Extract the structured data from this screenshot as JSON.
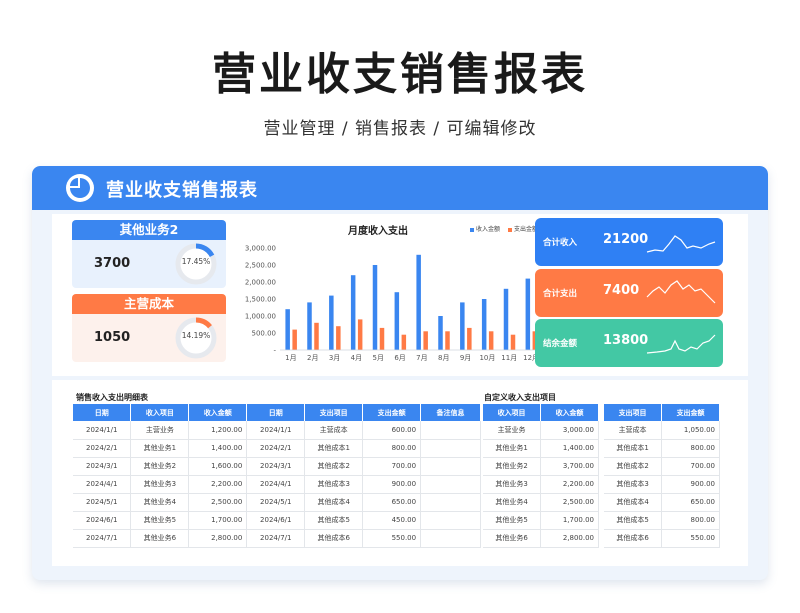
{
  "hero": {
    "title": "营业收支销售报表",
    "subtitle": "营业管理 / 销售报表 / 可编辑修改"
  },
  "panel": {
    "title": "营业收支销售报表",
    "logo_icon": "pie-chart-icon",
    "accent": "#3a86f0"
  },
  "kpi_cards": [
    {
      "label": "其他业务2",
      "value": "3700",
      "pct": "17.45%",
      "pct_value": 0.1745,
      "color": "#3a86f0"
    },
    {
      "label": "主营成本",
      "value": "1050",
      "pct": "14.19%",
      "pct_value": 0.1419,
      "color": "#ff7a45"
    }
  ],
  "summary_cards": [
    {
      "label": "合计收入",
      "value": "21200",
      "color": "#2f80f4",
      "icon": "sparkline-icon"
    },
    {
      "label": "合计支出",
      "value": "7400",
      "color": "#ff7a45",
      "icon": "sparkline-icon"
    },
    {
      "label": "结余金额",
      "value": "13800",
      "color": "#43c8a4",
      "icon": "sparkline-icon"
    }
  ],
  "chart_data": {
    "type": "bar",
    "title": "月度收入支出",
    "categories": [
      "1月",
      "2月",
      "3月",
      "4月",
      "5月",
      "6月",
      "7月",
      "8月",
      "9月",
      "10月",
      "11月",
      "12月"
    ],
    "series": [
      {
        "name": "收入金额",
        "color": "#3a86f0",
        "values": [
          1200,
          1400,
          1600,
          2200,
          2500,
          1700,
          2800,
          1000,
          1400,
          1500,
          1800,
          2100
        ]
      },
      {
        "name": "支出金额",
        "color": "#ff7a45",
        "values": [
          600,
          800,
          700,
          900,
          650,
          450,
          550,
          550,
          650,
          550,
          450,
          550
        ]
      }
    ],
    "ylim": [
      0,
      3000
    ],
    "yticks": [
      "-",
      "500.00",
      "1,000.00",
      "1,500.00",
      "2,000.00",
      "2,500.00",
      "3,000.00"
    ],
    "legend_position": "top-right",
    "grid": false
  },
  "detail_table": {
    "title": "销售收入支出明细表",
    "columns": [
      "日期",
      "收入项目",
      "收入金额",
      "日期",
      "支出项目",
      "支出金额",
      "备注信息"
    ],
    "rows": [
      [
        "2024/1/1",
        "主营业务",
        "1,200.00",
        "2024/1/1",
        "主营成本",
        "600.00",
        ""
      ],
      [
        "2024/2/1",
        "其他业务1",
        "1,400.00",
        "2024/2/1",
        "其他成本1",
        "800.00",
        ""
      ],
      [
        "2024/3/1",
        "其他业务2",
        "1,600.00",
        "2024/3/1",
        "其他成本2",
        "700.00",
        ""
      ],
      [
        "2024/4/1",
        "其他业务3",
        "2,200.00",
        "2024/4/1",
        "其他成本3",
        "900.00",
        ""
      ],
      [
        "2024/5/1",
        "其他业务4",
        "2,500.00",
        "2024/5/1",
        "其他成本4",
        "650.00",
        ""
      ],
      [
        "2024/6/1",
        "其他业务5",
        "1,700.00",
        "2024/6/1",
        "其他成本5",
        "450.00",
        ""
      ],
      [
        "2024/7/1",
        "其他业务6",
        "2,800.00",
        "2024/7/1",
        "其他成本6",
        "550.00",
        ""
      ]
    ]
  },
  "custom_table": {
    "title": "自定义收入支出项目",
    "income_columns": [
      "收入项目",
      "收入金额"
    ],
    "expense_columns": [
      "支出项目",
      "支出金额"
    ],
    "income_rows": [
      [
        "主营业务",
        "3,000.00"
      ],
      [
        "其他业务1",
        "1,400.00"
      ],
      [
        "其他业务2",
        "3,700.00"
      ],
      [
        "其他业务3",
        "2,200.00"
      ],
      [
        "其他业务4",
        "2,500.00"
      ],
      [
        "其他业务5",
        "1,700.00"
      ],
      [
        "其他业务6",
        "2,800.00"
      ]
    ],
    "expense_rows": [
      [
        "主营成本",
        "1,050.00"
      ],
      [
        "其他成本1",
        "800.00"
      ],
      [
        "其他成本2",
        "700.00"
      ],
      [
        "其他成本3",
        "900.00"
      ],
      [
        "其他成本4",
        "650.00"
      ],
      [
        "其他成本5",
        "800.00"
      ],
      [
        "其他成本6",
        "550.00"
      ]
    ]
  }
}
